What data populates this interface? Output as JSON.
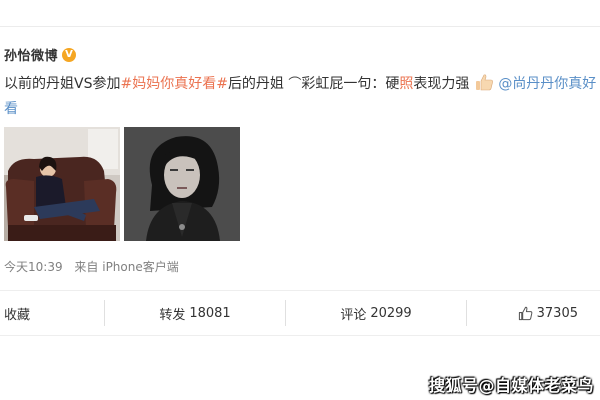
{
  "post": {
    "author": "孙怡微博",
    "verified_badge": "V",
    "text": {
      "line1_a": "以前的丹姐VS参加",
      "hashtag": "#妈妈你真好看#",
      "line1_b": "后的丹姐 ",
      "rainbow_icon": "⌒",
      "line1_c": "彩虹屁一句：硬",
      "emphasis": "照",
      "line1_d": "表现力强",
      "mention": "@尚丹丹你真好",
      "line2": "看"
    },
    "images": [
      {
        "alt": "woman sitting on brown leather sofa"
      },
      {
        "alt": "black and white portrait of woman"
      }
    ],
    "meta": {
      "time": "今天10:39",
      "source": "来自 iPhone客户端"
    }
  },
  "actions": {
    "collect": "收藏",
    "repost_label": "转发",
    "repost_count": "18081",
    "comment_label": "评论",
    "comment_count": "20299",
    "like_count": "37305"
  },
  "watermark": "搜狐号@自媒体老菜鸟",
  "colors": {
    "hashtag": "#eb7350",
    "mention": "#5a8fc7",
    "badge": "#f5a623"
  }
}
